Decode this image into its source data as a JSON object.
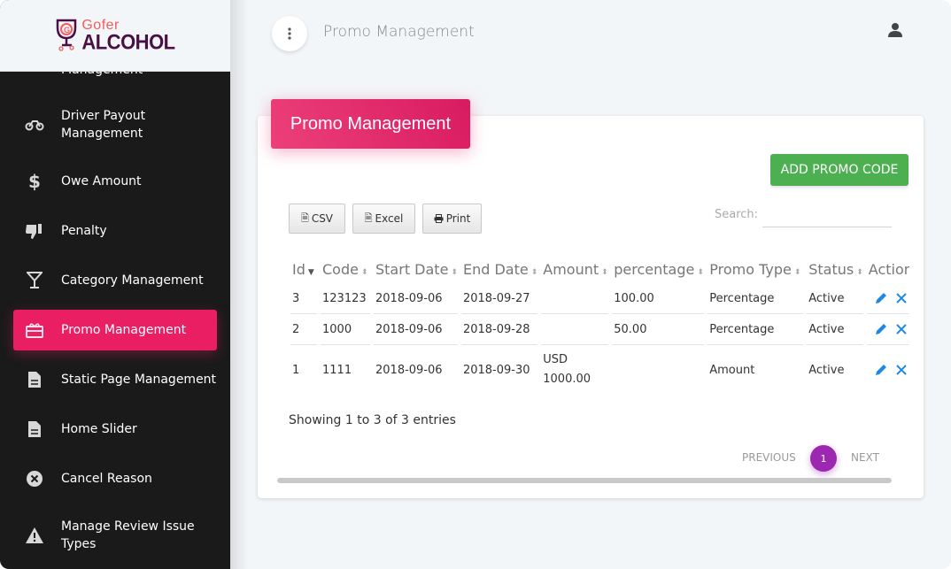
{
  "brand": {
    "line1": "Gofer",
    "line2": "ALCOHOL"
  },
  "sidebar": {
    "items": [
      {
        "label": "Management",
        "icon": "list-icon"
      },
      {
        "label": "Driver Payout Management",
        "line1": "Driver Payout",
        "line2": "Management",
        "icon": "motorcycle-icon"
      },
      {
        "label": "Owe Amount",
        "icon": "dollar-icon"
      },
      {
        "label": "Penalty",
        "icon": "thumbs-down-icon"
      },
      {
        "label": "Category Management",
        "icon": "cocktail-glass-icon"
      },
      {
        "label": "Promo Management",
        "icon": "gift-card-icon",
        "active": true
      },
      {
        "label": "Static Page Management",
        "icon": "document-icon"
      },
      {
        "label": "Home Slider",
        "icon": "document-icon"
      },
      {
        "label": "Cancel Reason",
        "icon": "cancel-circle-icon"
      },
      {
        "label": "Manage Review Issue Types",
        "line1": "Manage Review Issue",
        "line2": "Types",
        "icon": "warning-icon"
      }
    ]
  },
  "topbar": {
    "title": "Promo Management"
  },
  "card": {
    "title": "Promo Management",
    "add_button": "ADD PROMO CODE",
    "export_buttons": {
      "csv": "CSV",
      "excel": "Excel",
      "print": "Print"
    },
    "search": {
      "label": "Search:",
      "value": "",
      "placeholder": ""
    }
  },
  "table": {
    "columns": [
      "Id",
      "Code",
      "Start Date",
      "End Date",
      "Amount",
      "percentage",
      "Promo Type",
      "Status",
      "Action"
    ],
    "rows": [
      {
        "id": "3",
        "code": "123123",
        "start": "2018-09-06",
        "end": "2018-09-27",
        "amount_line1": "",
        "amount_line2": "",
        "percentage": "100.00",
        "type": "Percentage",
        "status": "Active"
      },
      {
        "id": "2",
        "code": "1000",
        "start": "2018-09-06",
        "end": "2018-09-28",
        "amount_line1": "",
        "amount_line2": "",
        "percentage": "50.00",
        "type": "Percentage",
        "status": "Active"
      },
      {
        "id": "1",
        "code": "1111",
        "start": "2018-09-06",
        "end": "2018-09-30",
        "amount_line1": "USD",
        "amount_line2": "1000.00",
        "percentage": "",
        "type": "Amount",
        "status": "Active"
      }
    ],
    "info": "Showing 1 to 3 of 3 entries"
  },
  "pagination": {
    "previous": "PREVIOUS",
    "current": "1",
    "next": "NEXT"
  },
  "colors": {
    "active_menu": "#e91e63",
    "add_button": "#4caf50",
    "page_current": "#9c27b0",
    "action_icons": "#1e88e5",
    "sidebar_bg": "#1a1a1a"
  }
}
